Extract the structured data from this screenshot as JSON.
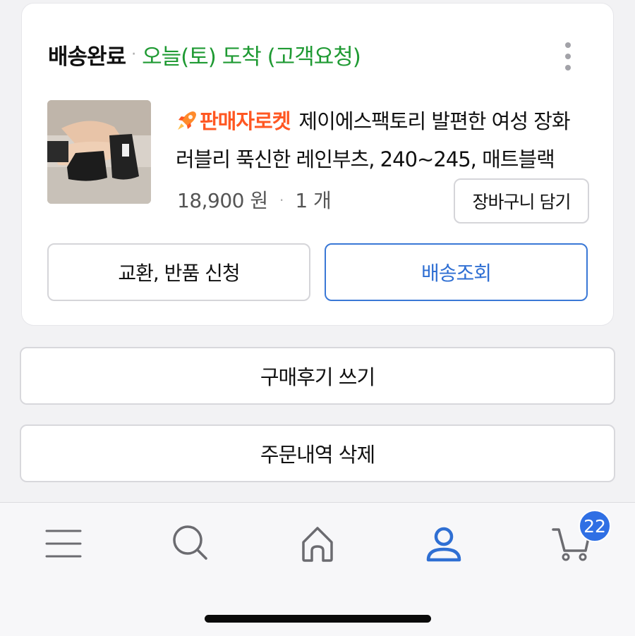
{
  "order": {
    "status": "배송완료",
    "separator": "·",
    "arrival": "오늘(토) 도착 (고객요청)",
    "more_icon": "more-vertical-icon",
    "product": {
      "image_icon": "product-thumbnail",
      "seller_badge": "판매자로켓",
      "badge_icon": "rocket-icon",
      "title": "제이에스팩토리 발편한 여성 장화 러블리 푹신한 레인부츠, 240~245, 매트블랙",
      "price": "18,900 원",
      "price_sep": "·",
      "quantity": "1 개",
      "add_to_cart_label": "장바구니 담기"
    },
    "exchange_label": "교환, 반품 신청",
    "tracking_label": "배송조회"
  },
  "review_label": "구매후기 쓰기",
  "delete_label": "주문내역 삭제",
  "tabbar": {
    "items": [
      {
        "icon": "menu-icon"
      },
      {
        "icon": "search-icon"
      },
      {
        "icon": "home-icon"
      },
      {
        "icon": "user-icon",
        "active": true
      },
      {
        "icon": "cart-icon"
      }
    ],
    "cart_count": "22"
  },
  "colors": {
    "arrival": "#1f9a33",
    "seller_badge": "#ff5722",
    "accent": "#2f6fd3",
    "badge": "#2f6fe4"
  }
}
